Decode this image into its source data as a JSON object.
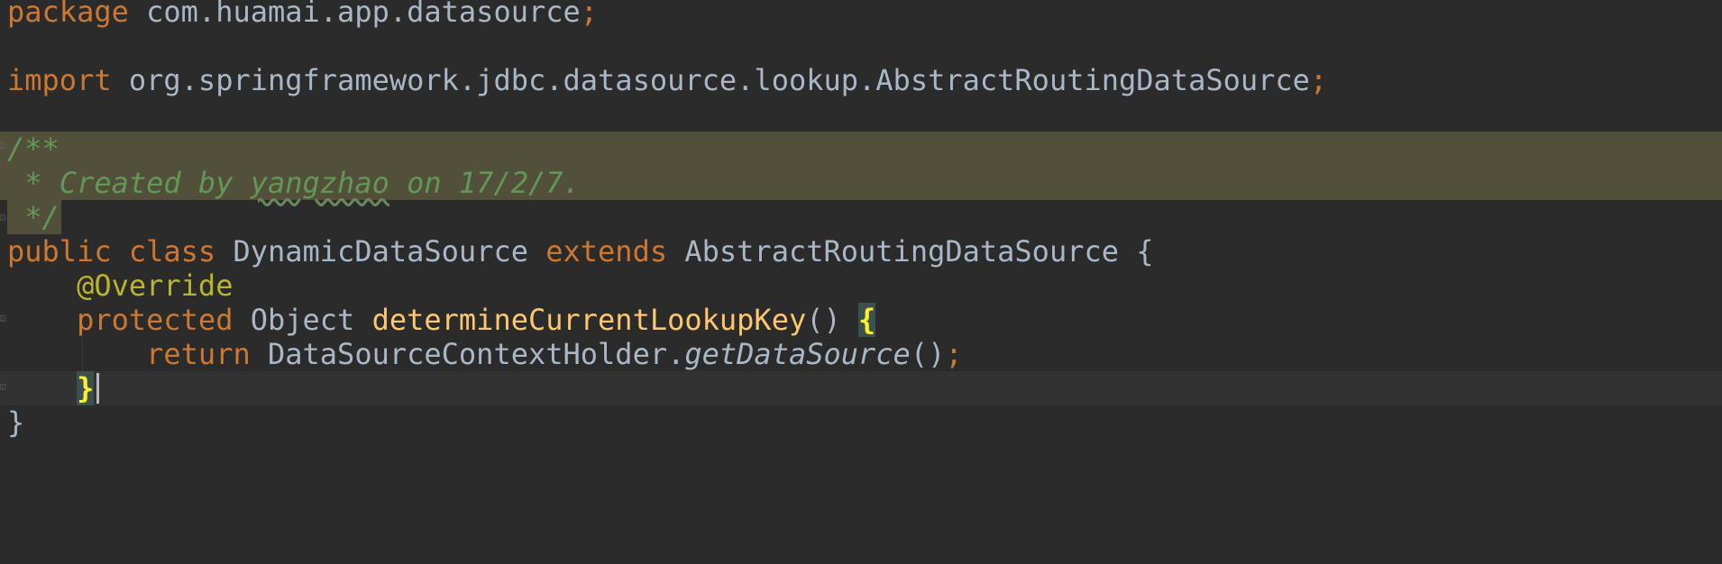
{
  "editor": {
    "lines": {
      "l1": {
        "kw": "package",
        "rest": " com.huamai.app.datasource",
        "semi": ";"
      },
      "l3": {
        "kw": "import",
        "rest": " org.springframework.jdbc.datasource.lookup.AbstractRoutingDataSource",
        "semi": ";"
      },
      "l5": {
        "text": "/**"
      },
      "l6": {
        "pre": " * Created by ",
        "name": "yangzhao",
        "post": " on 17/2/7."
      },
      "l7": {
        "text": " */"
      },
      "l8": {
        "kw1": "public",
        "kw2": "class",
        "cls": " DynamicDataSource ",
        "kw3": "extends",
        "parent": " AbstractRoutingDataSource {"
      },
      "l9": {
        "ann": "@Override"
      },
      "l10": {
        "kw": "protected",
        "type": " Object ",
        "meth": "determineCurrentLookupKey",
        "parens": "() ",
        "brace": "{"
      },
      "l11": {
        "kw": "return",
        "holder": " DataSourceContextHolder.",
        "call": "getDataSource",
        "parens": "()",
        "semi": ";"
      },
      "l12": {
        "brace": "}"
      },
      "l13": {
        "brace": "}"
      }
    }
  }
}
